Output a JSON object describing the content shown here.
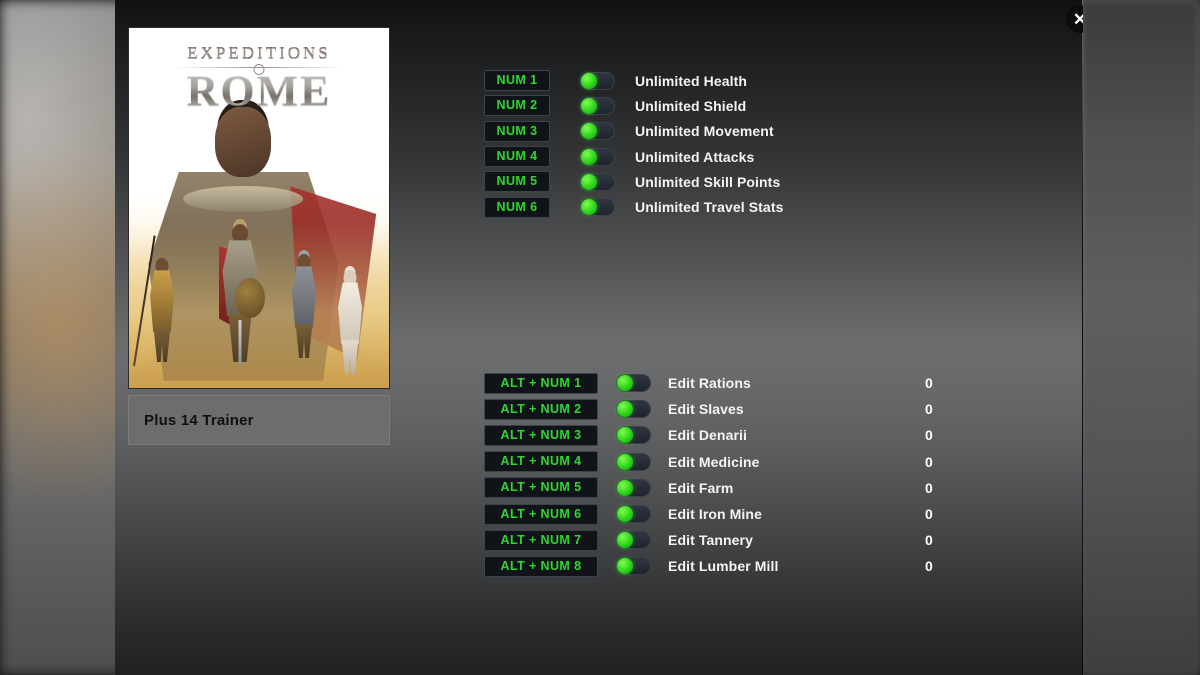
{
  "window": {
    "close_label": "✕"
  },
  "cover": {
    "logo_top": "EXPEDITIONS",
    "logo_main": "ROME",
    "trainer_name": "Plus 14 Trainer"
  },
  "sections": [
    {
      "id": "main",
      "rows": [
        {
          "hotkey": "NUM 1",
          "label": "Unlimited Health",
          "state": "on"
        },
        {
          "hotkey": "NUM 2",
          "label": "Unlimited Shield",
          "state": "on"
        },
        {
          "hotkey": "NUM 3",
          "label": "Unlimited Movement",
          "state": "on"
        },
        {
          "hotkey": "NUM 4",
          "label": "Unlimited Attacks",
          "state": "on"
        },
        {
          "hotkey": "NUM 5",
          "label": "Unlimited Skill Points",
          "state": "on"
        },
        {
          "hotkey": "NUM 6",
          "label": "Unlimited Travel Stats",
          "state": "on"
        }
      ]
    },
    {
      "id": "edit",
      "rows": [
        {
          "hotkey": "ALT + NUM 1",
          "label": "Edit Rations",
          "value": "0",
          "state": "on"
        },
        {
          "hotkey": "ALT + NUM 2",
          "label": "Edit Slaves",
          "value": "0",
          "state": "on"
        },
        {
          "hotkey": "ALT + NUM 3",
          "label": "Edit Denarii",
          "value": "0",
          "state": "on"
        },
        {
          "hotkey": "ALT + NUM 4",
          "label": "Edit Medicine",
          "value": "0",
          "state": "on"
        },
        {
          "hotkey": "ALT + NUM 5",
          "label": "Edit Farm",
          "value": "0",
          "state": "on"
        },
        {
          "hotkey": "ALT + NUM 6",
          "label": "Edit Iron Mine",
          "value": "0",
          "state": "on"
        },
        {
          "hotkey": "ALT + NUM 7",
          "label": "Edit Tannery",
          "value": "0",
          "state": "on"
        },
        {
          "hotkey": "ALT + NUM 8",
          "label": "Edit Lumber Mill",
          "value": "0",
          "state": "on"
        }
      ]
    }
  ],
  "colors": {
    "hotkey_text": "#2fd62f",
    "toggle_on": "#25cc16",
    "label_text": "#f4f4f4",
    "panel_mid": "#6b6c6d"
  }
}
